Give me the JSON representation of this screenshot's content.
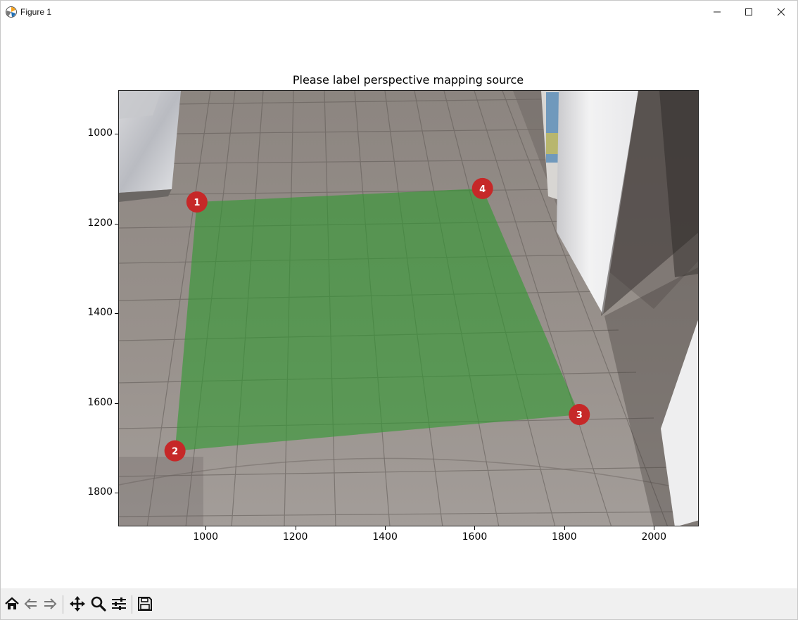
{
  "window": {
    "title": "Figure 1",
    "controls": {
      "minimize_icon": "minimize-icon",
      "maximize_icon": "maximize-icon",
      "close_icon": "close-icon"
    }
  },
  "figure": {
    "title": "Please label perspective mapping source",
    "image_description": "overhead camera frame of a tiled hallway floor with a green quadrilateral overlay"
  },
  "chart_data": {
    "type": "scatter",
    "title": "Please label perspective mapping source",
    "xlabel": "",
    "ylabel": "",
    "xlim": [
      805,
      2100
    ],
    "ylim": [
      1875,
      902
    ],
    "y_inverted": true,
    "xticks": [
      1000,
      1200,
      1400,
      1600,
      1800,
      2000
    ],
    "yticks": [
      1000,
      1200,
      1400,
      1600,
      1800
    ],
    "grid": false,
    "overlay_color": "#2e9a2e",
    "marker_color": "#c62828",
    "points": [
      {
        "label": "1",
        "x": 979,
        "y": 1150
      },
      {
        "label": "2",
        "x": 930,
        "y": 1705
      },
      {
        "label": "3",
        "x": 1832,
        "y": 1624
      },
      {
        "label": "4",
        "x": 1616,
        "y": 1120
      }
    ]
  },
  "toolbar": {
    "buttons": [
      {
        "name": "home-button",
        "icon": "home-icon"
      },
      {
        "name": "back-button",
        "icon": "back-arrow-icon"
      },
      {
        "name": "forward-button",
        "icon": "forward-arrow-icon"
      },
      {
        "name": "pan-button",
        "icon": "move-icon"
      },
      {
        "name": "zoom-button",
        "icon": "zoom-icon"
      },
      {
        "name": "configure-subplots-button",
        "icon": "sliders-icon"
      },
      {
        "name": "save-button",
        "icon": "save-icon"
      }
    ]
  }
}
